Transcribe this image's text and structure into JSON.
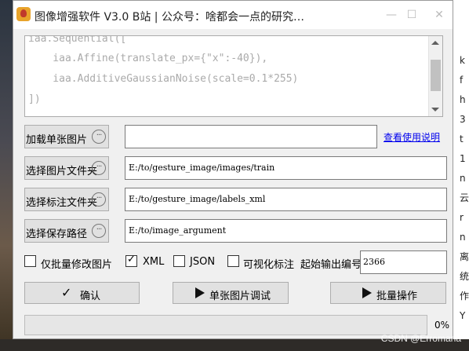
{
  "window": {
    "title": "图像增强软件 V3.0   B站 | 公众号：啥都会一点的研究…"
  },
  "code_lines": [
    "iaa.Sequential([",
    "    iaa.Affine(translate_px={\"x\":-40}),",
    "    iaa.AdditiveGaussianNoise(scale=0.1*255)",
    "])"
  ],
  "rows": {
    "load_single": {
      "label": "加载单张图片",
      "value": ""
    },
    "image_folder": {
      "label": "选择图片文件夹",
      "value": "E:/to/gesture_image/images/train"
    },
    "label_folder": {
      "label": "选择标注文件夹",
      "value": "E:/to/gesture_image/labels_xml"
    },
    "save_path": {
      "label": "选择保存路径",
      "value": "E:/to/image_argument"
    }
  },
  "help_link": "查看使用说明",
  "options": {
    "batch_modify": {
      "label": "仅批量修改图片",
      "checked": false
    },
    "xml": {
      "label": "XML",
      "checked": true
    },
    "json": {
      "label": "JSON",
      "checked": false
    },
    "visualize": {
      "label": "可视化标注",
      "checked": false
    },
    "start_index_label": "起始输出编号",
    "start_index_value": "2366"
  },
  "actions": {
    "confirm": "确认",
    "single_debug": "单张图片调试",
    "batch": "批量操作"
  },
  "progress": {
    "value": 0,
    "text": "0%"
  },
  "background": {
    "right_chars": [
      "k",
      "f",
      "h",
      "3",
      "t",
      "1",
      "n",
      "云",
      "r",
      "n",
      "离",
      "统",
      "作",
      "Y"
    ],
    "watermark": "CSDN @Erromana"
  },
  "colors": {
    "progress_fill": "#06b025",
    "link": "#0000ee"
  }
}
